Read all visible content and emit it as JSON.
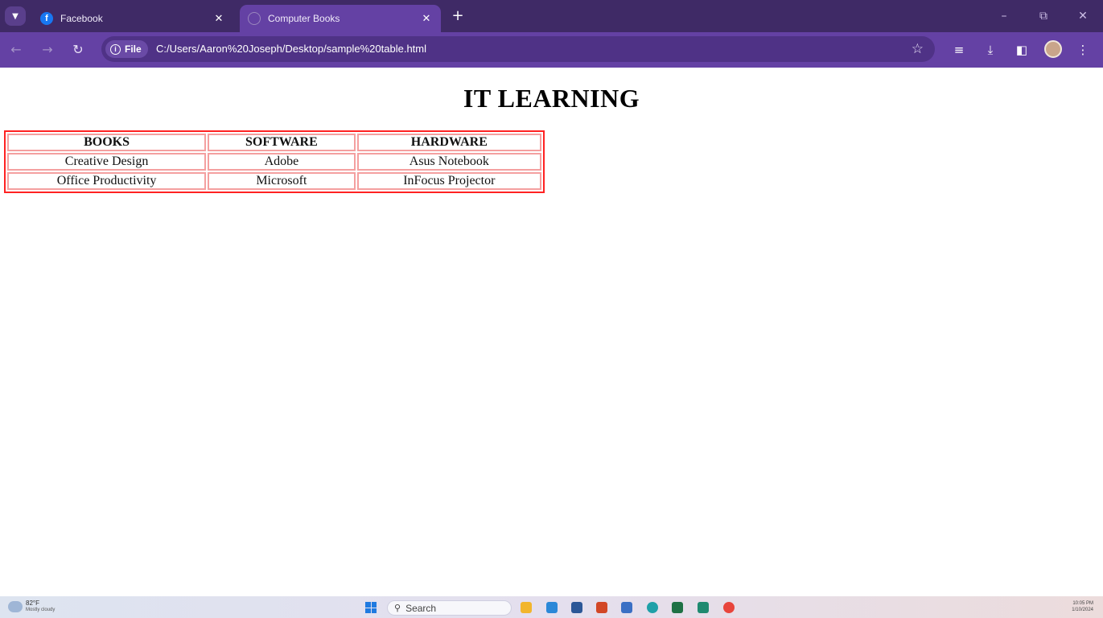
{
  "browser": {
    "tabs": [
      {
        "title": "Facebook",
        "favicon": "facebook-icon",
        "active": false
      },
      {
        "title": "Computer Books",
        "favicon": "globe-icon",
        "active": true
      }
    ],
    "address": {
      "chip_label": "File",
      "url": "C:/Users/Aaron%20Joseph/Desktop/sample%20table.html"
    },
    "colors": {
      "tabbar": "#3f2a66",
      "toolbar": "#6441a4",
      "table_border": "#ff2222",
      "cell_border": "#f4a0a0"
    }
  },
  "page": {
    "heading": "IT LEARNING",
    "table": {
      "headers": [
        "BOOKS",
        "SOFTWARE",
        "HARDWARE"
      ],
      "rows": [
        [
          "Creative Design",
          "Adobe",
          "Asus Notebook"
        ],
        [
          "Office Productivity",
          "Microsoft",
          "InFocus Projector"
        ]
      ]
    }
  },
  "taskbar": {
    "weather": {
      "temp": "82°F",
      "condition": "Mostly cloudy"
    },
    "search_placeholder": "Search",
    "clock": {
      "time": "10:05 PM",
      "date": "1/10/2024"
    }
  }
}
